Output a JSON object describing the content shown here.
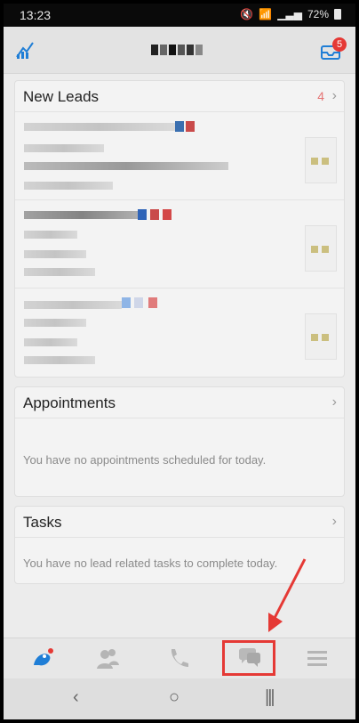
{
  "status": {
    "time": "13:23",
    "battery": "72%"
  },
  "header": {
    "badge_count": "5"
  },
  "sections": {
    "new_leads": {
      "title": "New Leads",
      "count": "4"
    },
    "appointments": {
      "title": "Appointments",
      "empty_text": "You have no appointments scheduled for today."
    },
    "tasks": {
      "title": "Tasks",
      "empty_text": "You have no lead related tasks to complete today."
    }
  },
  "bottom_nav": {
    "items": [
      "logo-icon",
      "contacts-icon",
      "phone-icon",
      "chat-icon",
      "menu-icon"
    ],
    "active": "chat-icon"
  },
  "android_nav": {
    "back": "‹",
    "home": "○",
    "recents": "|||"
  },
  "colors": {
    "accent_blue": "#1f7ed6",
    "red": "#e53935"
  }
}
